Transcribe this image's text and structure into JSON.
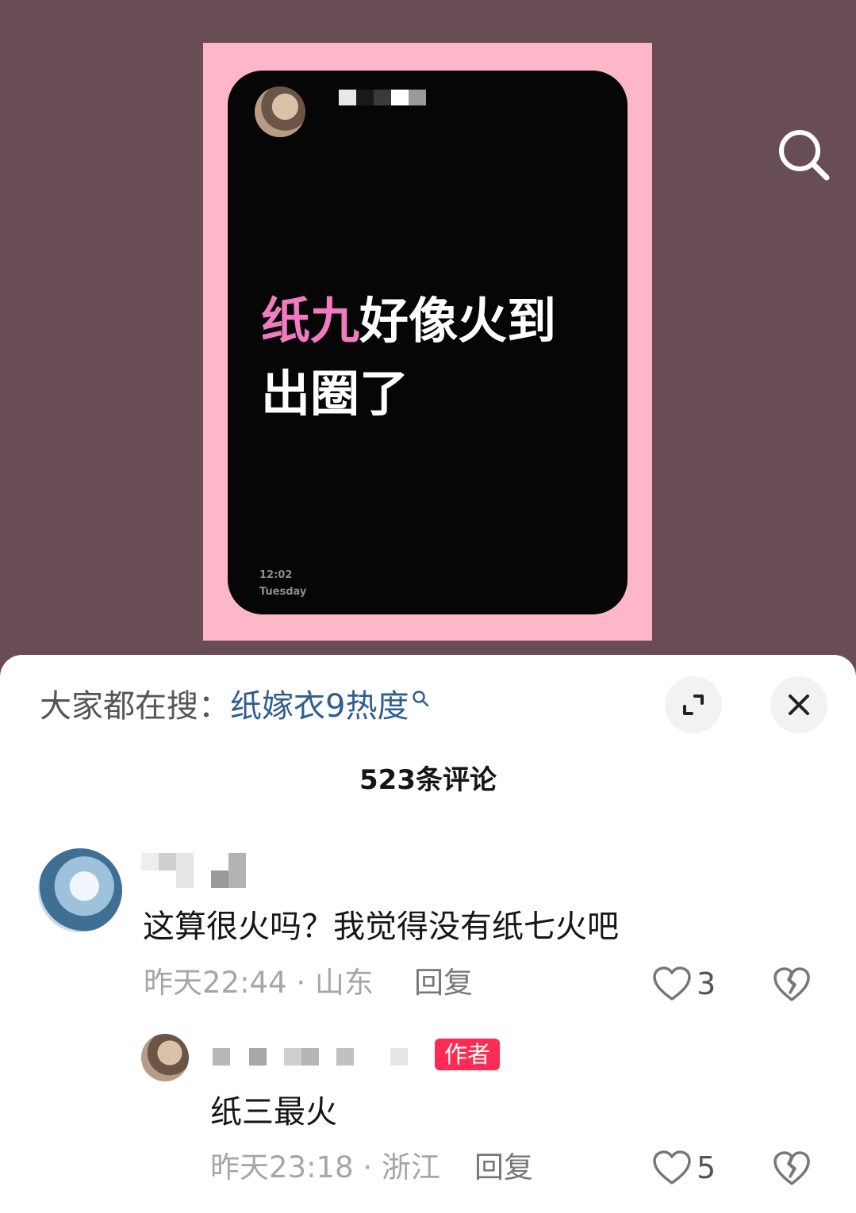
{
  "poster": {
    "headline_highlight": "纸九",
    "headline_line1_rest": "好像火到",
    "headline_line2": "出圈了",
    "time": "12:02",
    "weekday": "Tuesday"
  },
  "top_actions": {
    "search_icon": "search-icon"
  },
  "sheet": {
    "trend_label": "大家都在搜：",
    "trend_term": "纸嫁衣9热度",
    "trend_icon": "search-icon",
    "expand_icon": "expand-icon",
    "close_icon": "close-icon",
    "comment_count": "523条评论"
  },
  "comments": [
    {
      "text": "这算很火吗？我觉得没有纸七火吧",
      "meta": "昨天22:44 · 山东",
      "reply_label": "回复",
      "likes": "3"
    }
  ],
  "replies": [
    {
      "badge": "作者",
      "text": "纸三最火",
      "meta": "昨天23:18 · 浙江",
      "reply_label": "回复",
      "likes": "5"
    }
  ],
  "colors": {
    "background": "#694d55",
    "poster": "#fdb7c9",
    "headline_highlight": "#f07bc0",
    "trend_term": "#2e5f8f",
    "author_badge": "#fe2c55"
  }
}
